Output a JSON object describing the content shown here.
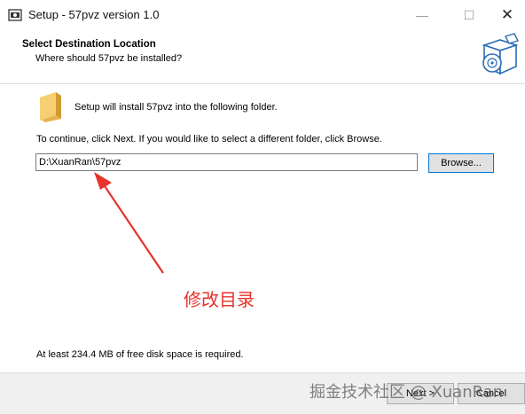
{
  "window": {
    "title": "Setup - 57pvz version 1.0",
    "minimize_glyph": "—",
    "maximize_glyph": "☐",
    "close_glyph": "✕"
  },
  "header": {
    "title": "Select Destination Location",
    "subtitle": "Where should 57pvz be installed?"
  },
  "main": {
    "install_text": "Setup will install 57pvz into the following folder.",
    "continue_text": "To continue, click Next. If you would like to select a different folder, click Browse.",
    "path_value": "D:\\XuanRan\\57pvz",
    "browse_label": "Browse...",
    "space_text": "At least 234.4 MB of free disk space is required."
  },
  "annotation": {
    "text": "修改目录",
    "color": "#e8322b"
  },
  "footer": {
    "next_label": "Next >",
    "cancel_label": "Cancel"
  },
  "watermark": "掘金技术社区 @ XuanRan",
  "icons": [
    "app-icon",
    "install-box-icon",
    "folder-icon",
    "arrow-icon"
  ]
}
